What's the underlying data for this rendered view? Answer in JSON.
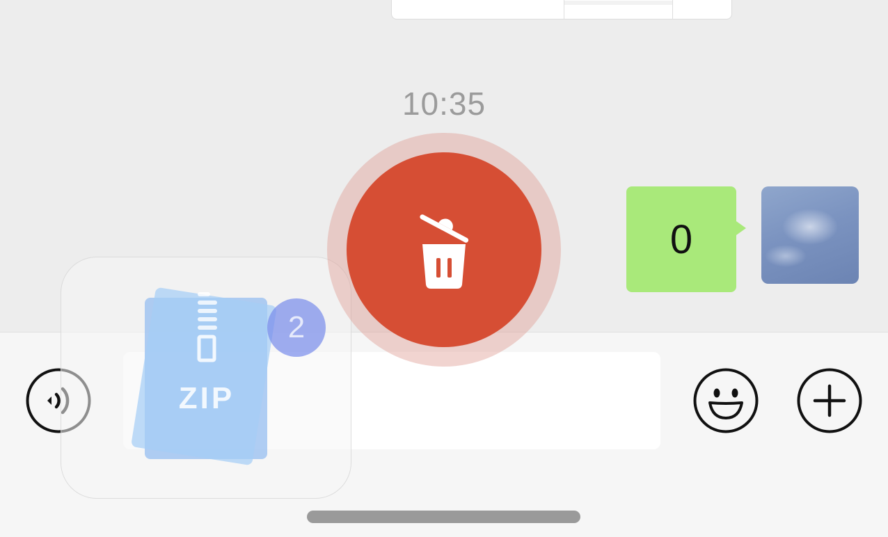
{
  "chat": {
    "timestamp": "10:35",
    "outgoing_message": {
      "text": "0",
      "bubble_color": "#a9e97a"
    },
    "avatar": {
      "icon": "sky-photo-avatar"
    }
  },
  "drag": {
    "file_type_label": "ZIP",
    "item_count": "2",
    "icon": "zip-file-icon"
  },
  "delete_target": {
    "icon": "trash-icon",
    "color": "#d64e34"
  },
  "input_bar": {
    "voice_icon": "voice-icon",
    "emoji_icon": "emoji-icon",
    "plus_icon": "plus-icon",
    "text_value": ""
  }
}
